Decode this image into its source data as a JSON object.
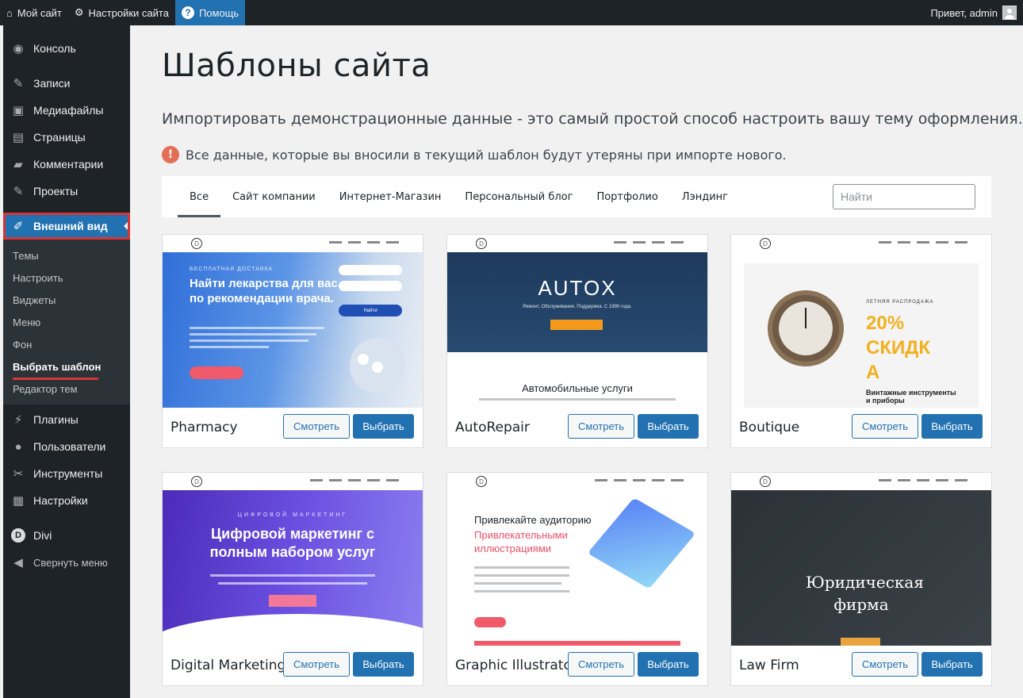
{
  "adminbar": {
    "my_site": "Мой сайт",
    "site_settings": "Настройки сайта",
    "help": "Помощь",
    "greeting": "Привет, admin"
  },
  "sidebar": {
    "items_top": [
      {
        "label": "Консоль",
        "icon": "dashboard-icon"
      },
      {
        "label": "Записи",
        "icon": "pin-icon"
      },
      {
        "label": "Медиафайлы",
        "icon": "media-icon"
      },
      {
        "label": "Страницы",
        "icon": "page-icon"
      },
      {
        "label": "Комментарии",
        "icon": "comment-icon"
      },
      {
        "label": "Проекты",
        "icon": "pin-icon"
      }
    ],
    "active": {
      "label": "Внешний вид",
      "icon": "brush-icon"
    },
    "submenu": [
      "Темы",
      "Настроить",
      "Виджеты",
      "Меню",
      "Фон",
      "Выбрать шаблон",
      "Редактор тем"
    ],
    "items_bottom": [
      {
        "label": "Плагины",
        "icon": "plugin-icon"
      },
      {
        "label": "Пользователи",
        "icon": "user-icon"
      },
      {
        "label": "Инструменты",
        "icon": "wrench-icon"
      },
      {
        "label": "Настройки",
        "icon": "settings-icon"
      }
    ],
    "divi": "Divi",
    "collapse": "Свернуть меню"
  },
  "page": {
    "title": "Шаблоны сайта",
    "lead": "Импортировать демонстрационные данные - это самый простой способ настроить вашу тему оформления.",
    "warning": "Все данные, которые вы вносили в текущий шаблон будут утеряны при импорте нового."
  },
  "filters": {
    "tabs": [
      "Все",
      "Сайт компании",
      "Интернет-Магазин",
      "Персональный блог",
      "Портфолио",
      "Лэндинг"
    ],
    "search_placeholder": "Найти"
  },
  "buttons": {
    "view": "Смотреть",
    "pick": "Выбрать"
  },
  "templates": [
    {
      "name": "Pharmacy",
      "thumb": {
        "kicker": "БЕСПЛАТНАЯ ДОСТАВКА",
        "headline": "Найти лекарства для вас по рекомендации врача.",
        "cta": "Найти"
      }
    },
    {
      "name": "AutoRepair",
      "thumb": {
        "headline": "AUTOX",
        "sub": "Ремонт. Обслуживание. Поддержка. С 1990 года.",
        "section": "Автомобильные услуги"
      }
    },
    {
      "name": "Boutique",
      "thumb": {
        "kicker": "ЛЕТНЯЯ РАСПРОДАЖА",
        "headline": "20% СКИДК А",
        "sub": "Винтажные инструменты и приборы"
      }
    },
    {
      "name": "Digital Marketing",
      "thumb": {
        "kicker": "ЦИФРОВОЙ МАРКЕТИНГ",
        "headline": "Цифровой маркетинг с полным набором услуг"
      }
    },
    {
      "name": "Graphic Illustrator",
      "thumb": {
        "headline": "Привлекайте аудиторию",
        "accent": "Привлекательными иллюстрациями"
      }
    },
    {
      "name": "Law Firm",
      "thumb": {
        "headline": "Юридическая фирма"
      }
    }
  ],
  "colors": {
    "accent": "#2271b1",
    "sidebar": "#1d2327",
    "highlight": "#d63638"
  }
}
